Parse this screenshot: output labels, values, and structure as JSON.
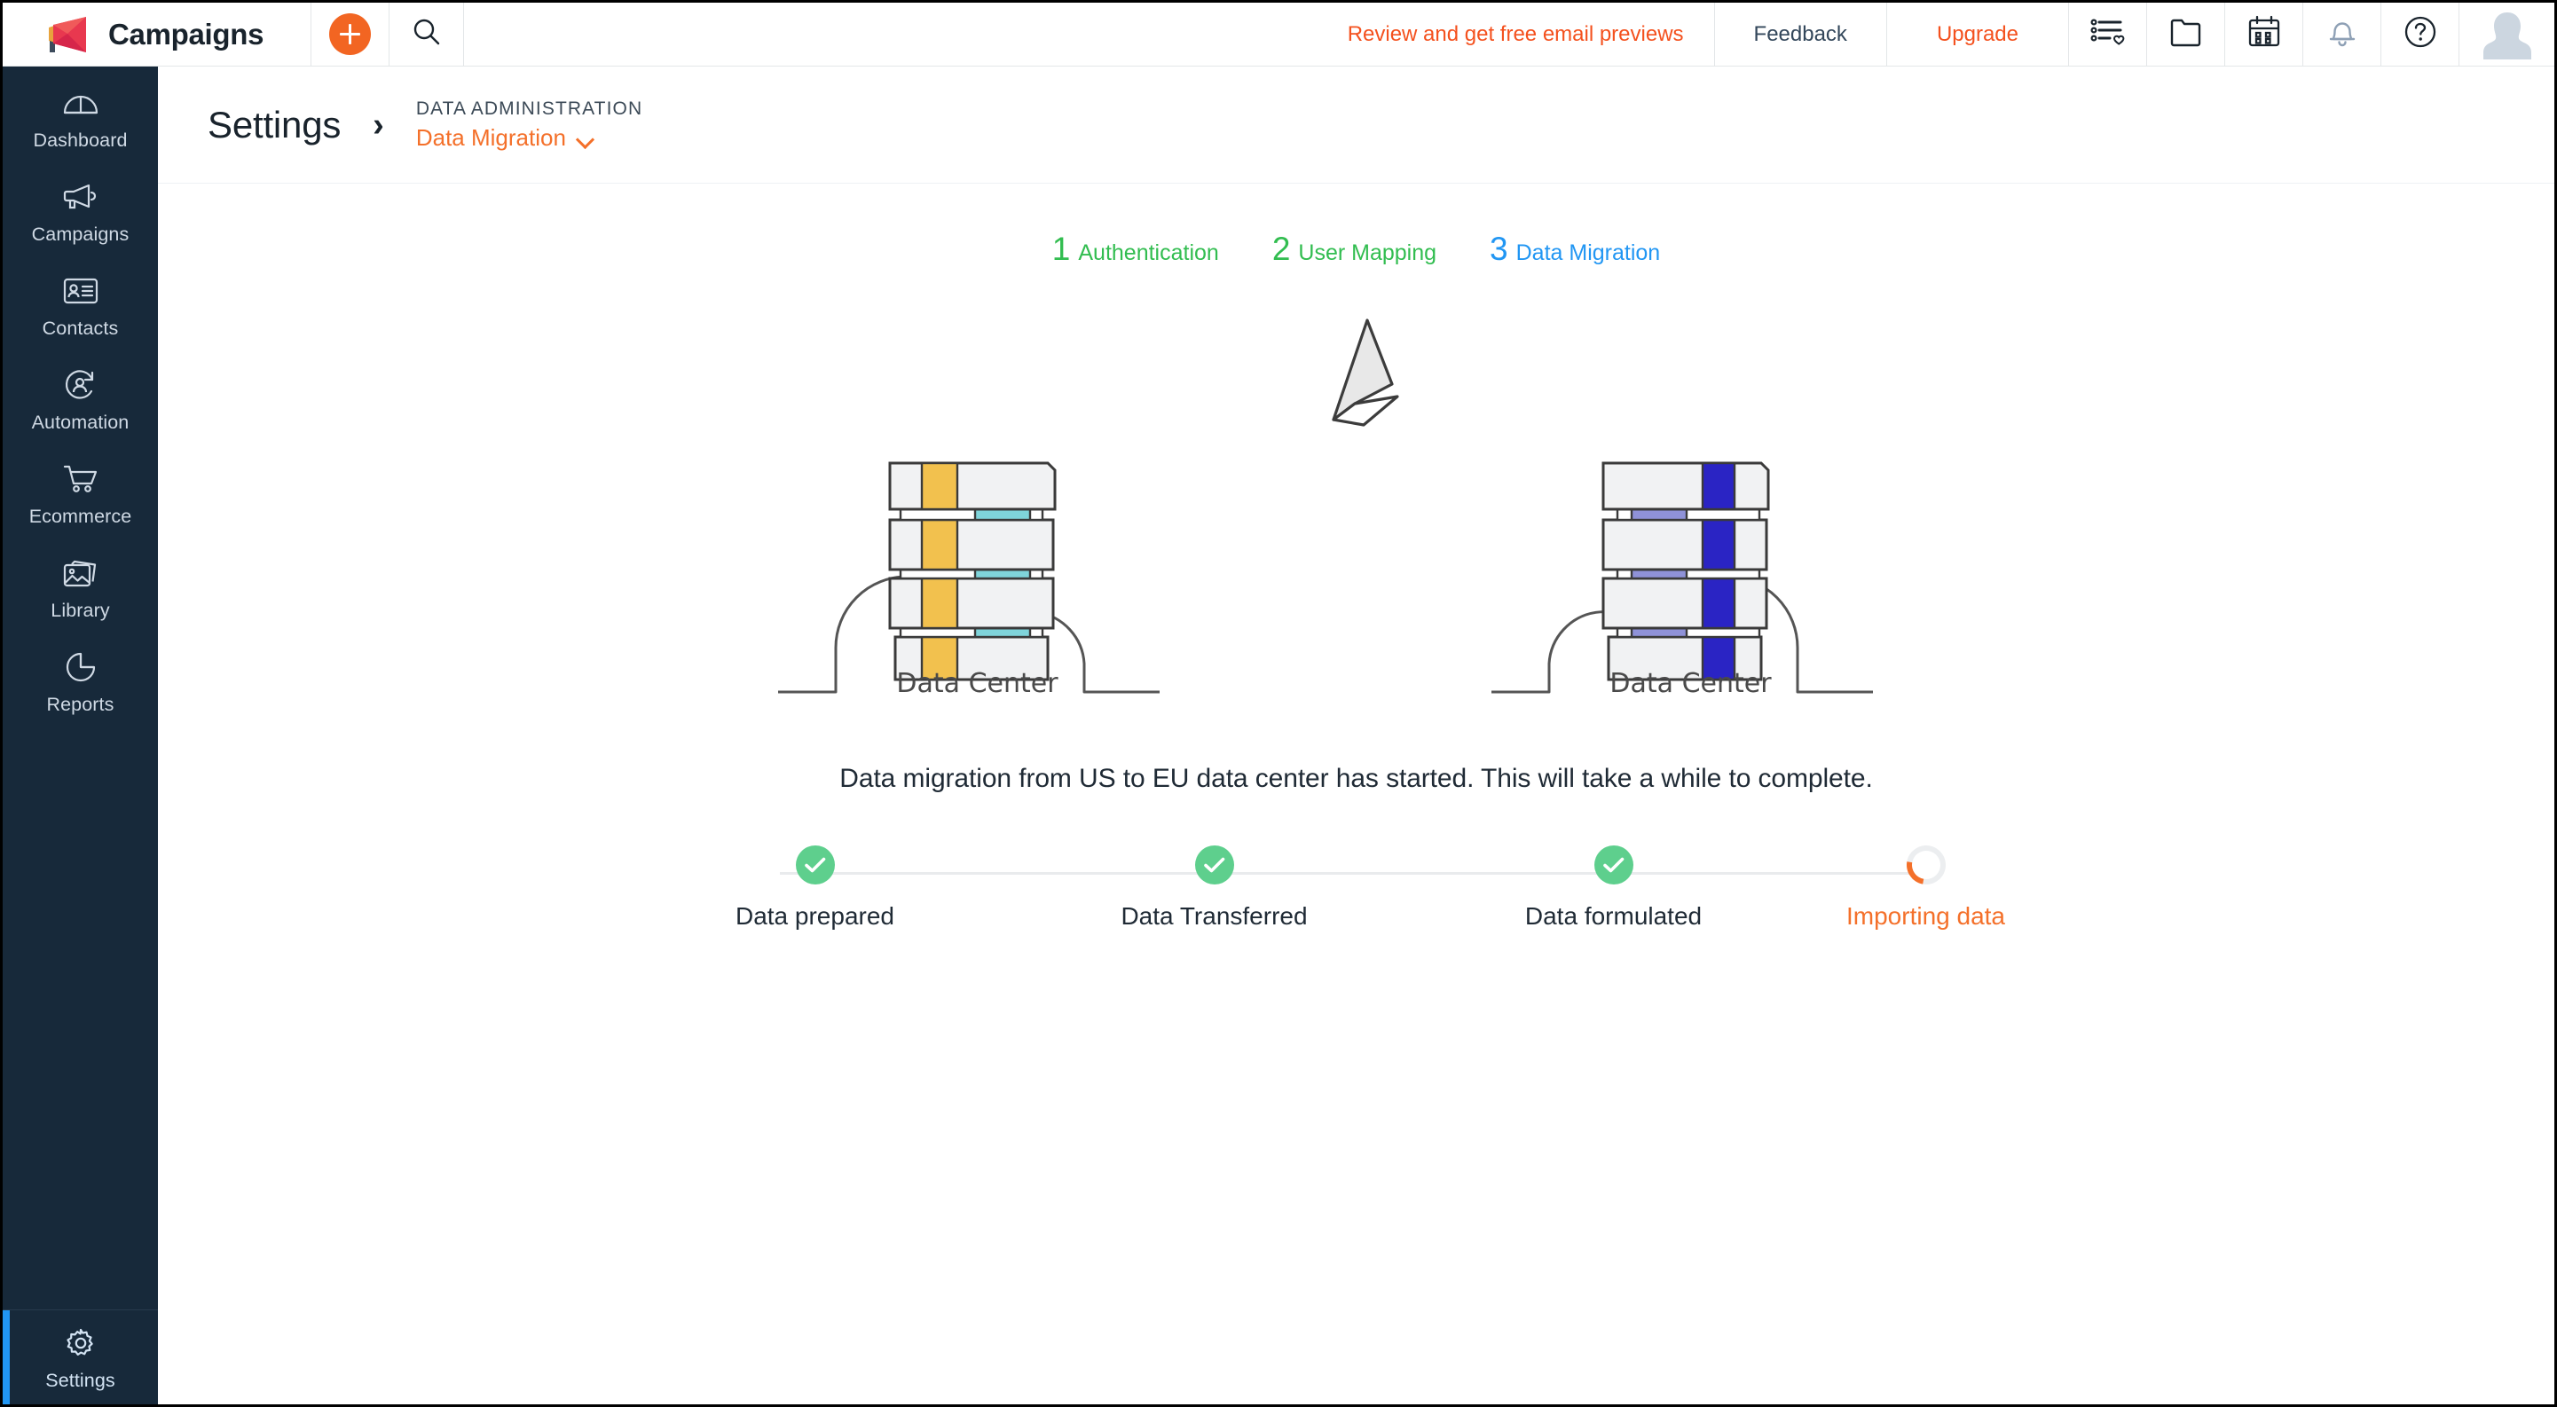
{
  "app": {
    "brand_name": "Campaigns",
    "logo_icon": "megaphone-logo"
  },
  "topbar": {
    "add_icon": "plus-icon",
    "search_icon": "search-icon",
    "review_link": "Review and get free email previews",
    "feedback_link": "Feedback",
    "upgrade_link": "Upgrade",
    "icons": [
      {
        "name": "list-heart-icon"
      },
      {
        "name": "folder-icon"
      },
      {
        "name": "calendar-icon"
      },
      {
        "name": "bell-icon"
      },
      {
        "name": "help-icon"
      }
    ],
    "avatar": "user-avatar",
    "accent_orange": "#f4511e",
    "link_color": "#33475b"
  },
  "sidebar": {
    "active_accent": "#2196f3",
    "background": "#17293a",
    "items": [
      {
        "label": "Dashboard",
        "icon": "dashboard-icon"
      },
      {
        "label": "Campaigns",
        "icon": "megaphone-icon"
      },
      {
        "label": "Contacts",
        "icon": "contact-card-icon"
      },
      {
        "label": "Automation",
        "icon": "automation-icon"
      },
      {
        "label": "Ecommerce",
        "icon": "cart-icon"
      },
      {
        "label": "Library",
        "icon": "images-icon"
      },
      {
        "label": "Reports",
        "icon": "pie-chart-icon"
      }
    ],
    "bottom_item": {
      "label": "Settings",
      "icon": "gear-icon",
      "active": true
    }
  },
  "breadcrumb": {
    "root": "Settings",
    "separator": "›",
    "section": "DATA ADMINISTRATION",
    "current": "Data Migration",
    "current_color": "#f4702a",
    "dropdown_icon": "chevron-down-icon"
  },
  "wizard": {
    "steps": [
      {
        "num": "1",
        "label": "Authentication",
        "state": "done",
        "color": "#32bd50"
      },
      {
        "num": "2",
        "label": "User Mapping",
        "state": "done",
        "color": "#32bd50"
      },
      {
        "num": "3",
        "label": "Data Migration",
        "state": "active",
        "color": "#2196f3"
      }
    ]
  },
  "illustration": {
    "source": {
      "caption": "Data Center",
      "accent_a": "#f2c14e",
      "accent_b": "#7fd4da"
    },
    "target": {
      "caption": "Data Center",
      "accent_a": "#2a24c4",
      "accent_b": "#8f92d8"
    },
    "plane_icon": "paper-plane-icon"
  },
  "status_message": "Data migration from US to EU data center has started. This will take a while to complete.",
  "progress": {
    "done_color": "#5ecf8d",
    "running_color": "#f4702a",
    "steps": [
      {
        "label": "Data prepared",
        "state": "done",
        "icon": "check-icon"
      },
      {
        "label": "Data Transferred",
        "state": "done",
        "icon": "check-icon"
      },
      {
        "label": "Data formulated",
        "state": "done",
        "icon": "check-icon"
      },
      {
        "label": "Importing data",
        "state": "running",
        "icon": "spinner-icon"
      }
    ]
  }
}
